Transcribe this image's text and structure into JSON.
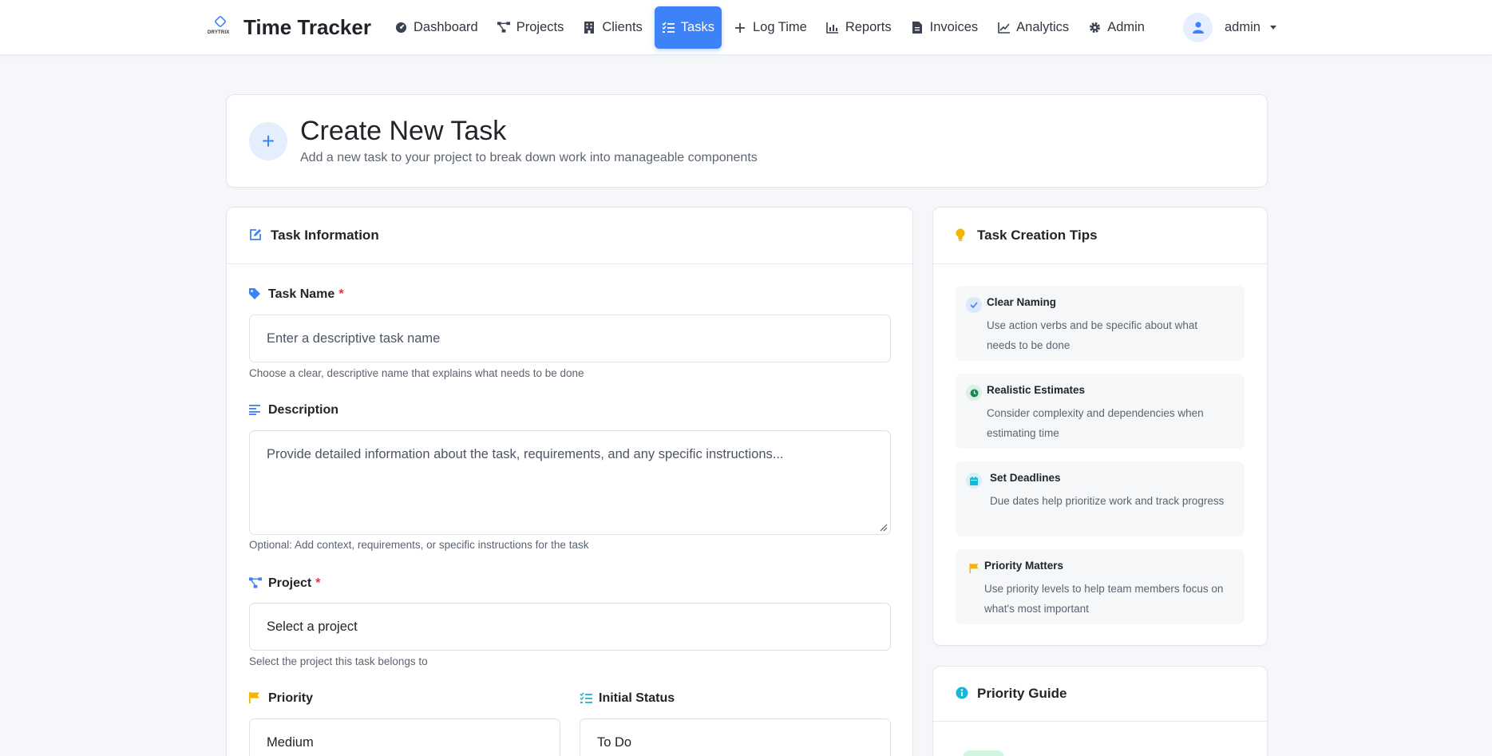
{
  "brand": {
    "logo_text": "DRYTRIX",
    "title": "Time Tracker"
  },
  "nav": {
    "items": [
      {
        "label": "Dashboard",
        "icon": "dashboard-icon",
        "active": false
      },
      {
        "label": "Projects",
        "icon": "project-diagram-icon",
        "active": false
      },
      {
        "label": "Clients",
        "icon": "building-icon",
        "active": false
      },
      {
        "label": "Tasks",
        "icon": "tasks-icon",
        "active": true
      },
      {
        "label": "Log Time",
        "icon": "plus-icon",
        "active": false
      },
      {
        "label": "Reports",
        "icon": "chart-bar-icon",
        "active": false
      },
      {
        "label": "Invoices",
        "icon": "invoice-icon",
        "active": false
      },
      {
        "label": "Analytics",
        "icon": "chart-line-icon",
        "active": false
      },
      {
        "label": "Admin",
        "icon": "gear-icon",
        "active": false
      }
    ],
    "user": {
      "name": "admin"
    }
  },
  "header": {
    "title": "Create New Task",
    "subtitle": "Add a new task to your project to break down work into manageable components"
  },
  "form": {
    "title": "Task Information",
    "task_name": {
      "label": "Task Name",
      "required_mark": "*",
      "placeholder": "Enter a descriptive task name",
      "help": "Choose a clear, descriptive name that explains what needs to be done"
    },
    "description": {
      "label": "Description",
      "placeholder": "Provide detailed information about the task, requirements, and any specific instructions...",
      "help": "Optional: Add context, requirements, or specific instructions for the task"
    },
    "project": {
      "label": "Project",
      "required_mark": "*",
      "value": "Select a project",
      "help": "Select the project this task belongs to"
    },
    "priority": {
      "label": "Priority",
      "value": "Medium"
    },
    "status": {
      "label": "Initial Status",
      "value": "To Do"
    }
  },
  "tips": {
    "title": "Task Creation Tips",
    "items": [
      {
        "title": "Clear Naming",
        "desc": "Use action verbs and be specific about what needs to be done",
        "icon": "check-icon"
      },
      {
        "title": "Realistic Estimates",
        "desc": "Consider complexity and dependencies when estimating time",
        "icon": "clock-icon"
      },
      {
        "title": "Set Deadlines",
        "desc": "Due dates help prioritize work and track progress",
        "icon": "calendar-icon"
      },
      {
        "title": "Priority Matters",
        "desc": "Use priority levels to help team members focus on what's most important",
        "icon": "flag-icon"
      }
    ]
  },
  "guide": {
    "title": "Priority Guide"
  },
  "colors": {
    "accent": "#3d82f6",
    "required": "#dc3545",
    "warning": "#f5b400",
    "success": "#198754",
    "info": "#17b8d6"
  }
}
